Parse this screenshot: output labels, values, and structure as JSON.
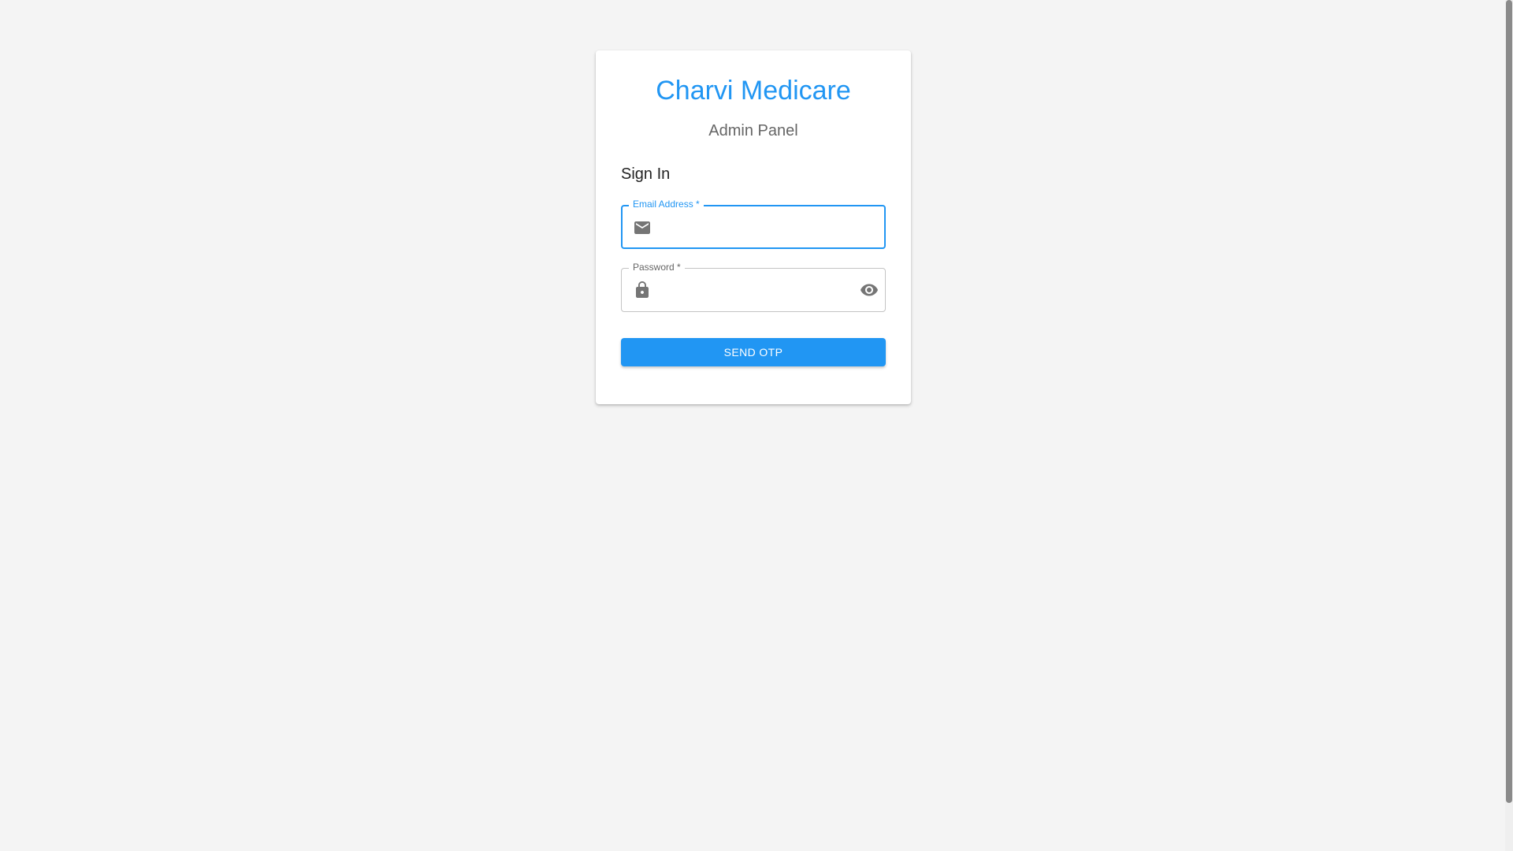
{
  "app": {
    "brand": "Charvi Medicare",
    "subtitle": "Admin Panel"
  },
  "login": {
    "title": "Sign In",
    "email": {
      "label": "Email Address *",
      "value": "",
      "icon": "mail-icon"
    },
    "password": {
      "label": "Password *",
      "value": "",
      "icon": "lock-icon",
      "toggle_icon": "eye-icon"
    },
    "submit_label": "SEND OTP"
  },
  "colors": {
    "primary": "#2196f3",
    "background": "#f4f4f4",
    "card": "#ffffff",
    "muted_text": "#666666",
    "icon": "#757575"
  }
}
